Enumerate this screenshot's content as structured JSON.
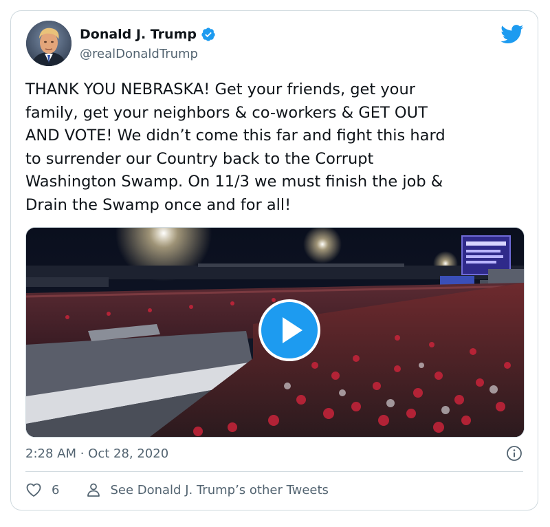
{
  "author": {
    "display_name": "Donald J. Trump",
    "handle": "@realDonaldTrump",
    "verified": true
  },
  "tweet": {
    "text": "THANK YOU NEBRASKA! Get your friends, get your\nfamily, get your neighbors & co-workers & GET OUT\nAND VOTE! We didn’t come this far and fight this hard\nto surrender our Country back to the Corrupt\nWashington Swamp. On 11/3 we must finish the job &\nDrain the Swamp once and for all!",
    "timestamp": "2:28 AM · Oct 28, 2020"
  },
  "media": {
    "type": "video",
    "play_icon": "play-icon"
  },
  "actions": {
    "like_count": "6",
    "other_tweets_label": "See Donald J. Trump’s other Tweets"
  },
  "colors": {
    "accent": "#1d9bf0",
    "text": "#0f1419",
    "secondary": "#536471",
    "border": "#cfd9de"
  },
  "icons": {
    "brand": "twitter-bird-icon",
    "verified": "verified-badge-icon",
    "info": "info-icon",
    "like": "heart-icon",
    "profile": "person-icon"
  }
}
